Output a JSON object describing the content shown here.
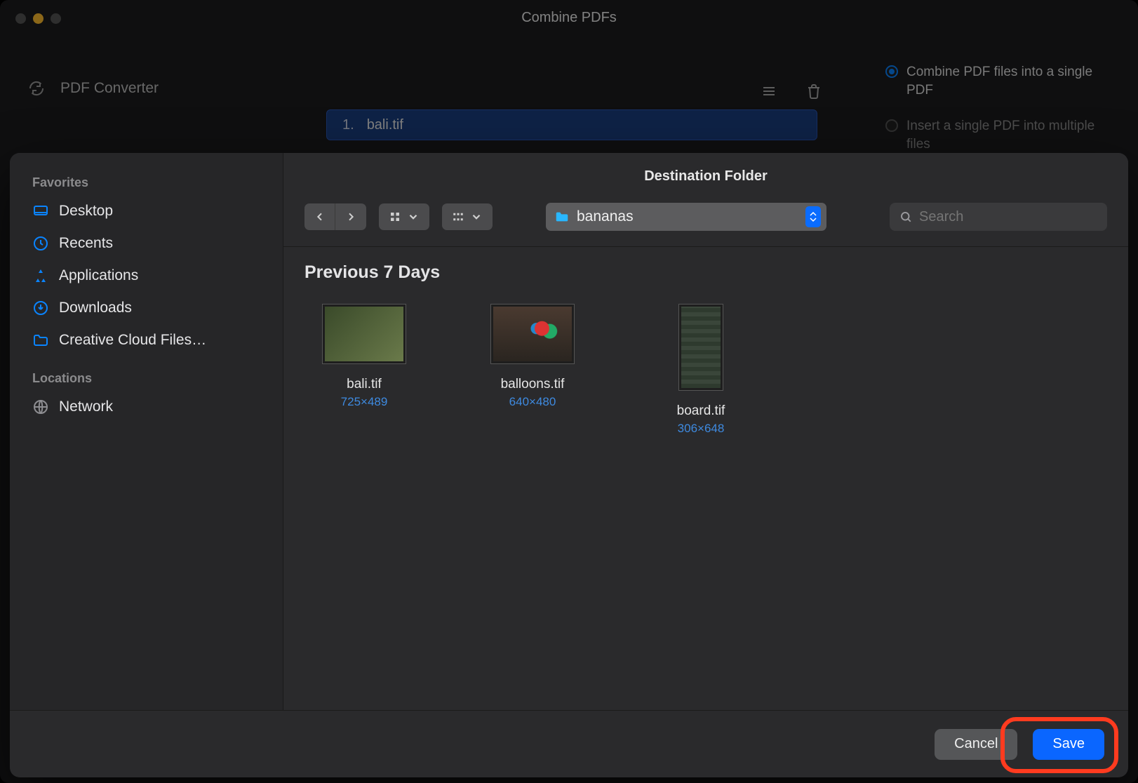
{
  "window": {
    "title": "Combine PDFs"
  },
  "app_left": {
    "name": "PDF Converter"
  },
  "file_row": {
    "index": "1.",
    "name": "bali.tif"
  },
  "options": {
    "combine": "Combine PDF files into a single PDF",
    "insert": "Insert a single PDF into multiple files"
  },
  "sheet": {
    "title": "Destination Folder",
    "folder": "bananas",
    "search_placeholder": "Search",
    "section": "Previous 7 Days",
    "cancel": "Cancel",
    "save": "Save"
  },
  "sidebar": {
    "favorites_label": "Favorites",
    "locations_label": "Locations",
    "desktop": "Desktop",
    "recents": "Recents",
    "applications": "Applications",
    "downloads": "Downloads",
    "ccf": "Creative Cloud Files…",
    "network": "Network"
  },
  "files": {
    "f0": {
      "name": "bali.tif",
      "dims": "725×489"
    },
    "f1": {
      "name": "balloons.tif",
      "dims": "640×480"
    },
    "f2": {
      "name": "board.tif",
      "dims": "306×648"
    }
  }
}
